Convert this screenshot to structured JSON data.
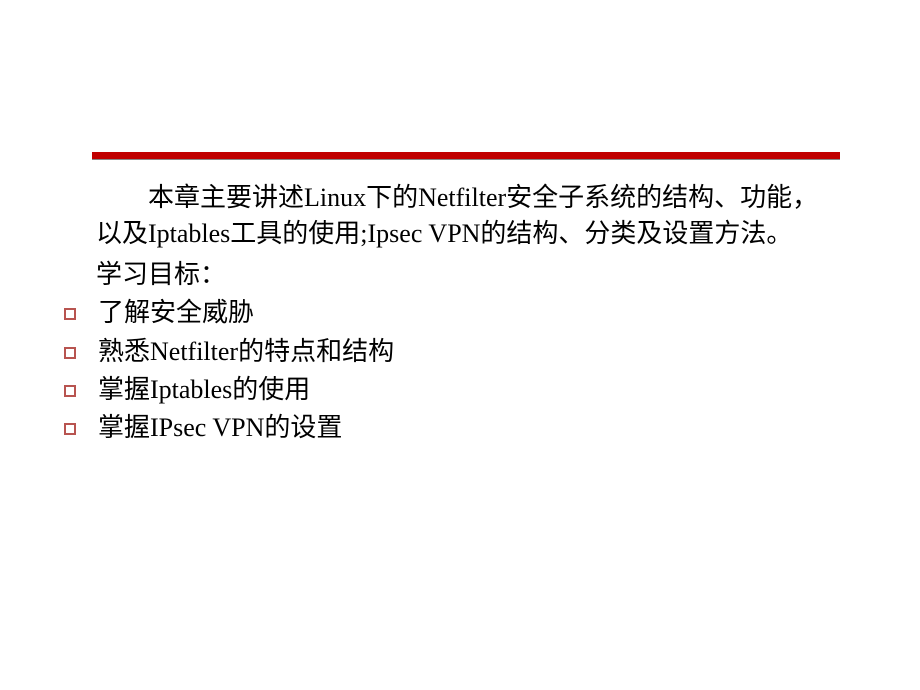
{
  "intro": "本章主要讲述Linux下的Netfilter安全子系统的结构、功能，以及Iptables工具的使用;Ipsec VPN的结构、分类及设置方法。",
  "subtitle": "学习目标：",
  "bullets": [
    "了解安全威胁",
    "熟悉Netfilter的特点和结构",
    "掌握Iptables的使用",
    "掌握IPsec VPN的设置"
  ]
}
